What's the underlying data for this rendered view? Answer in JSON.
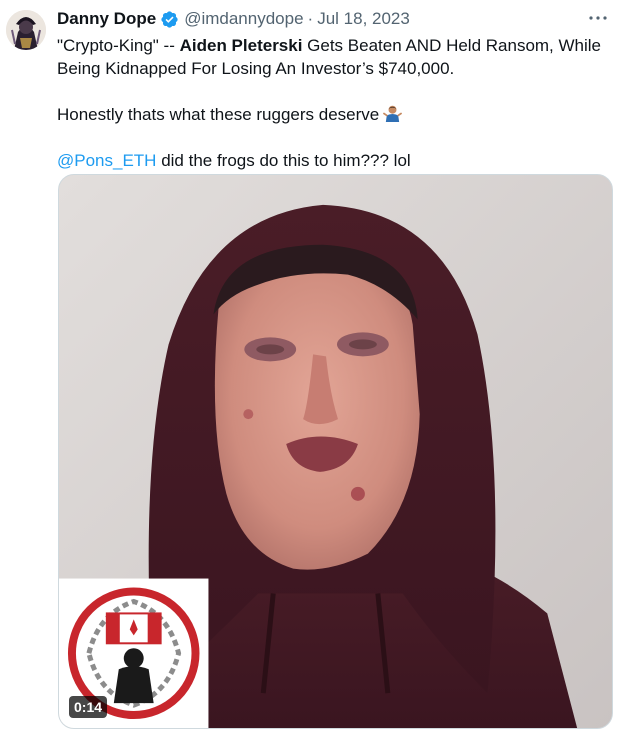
{
  "tweet": {
    "author": {
      "display_name": "Danny Dope",
      "handle": "@imdannydope",
      "verified": true
    },
    "separator": "·",
    "date": "Jul 18, 2023",
    "more_icon": "more-dots-icon",
    "text": {
      "line1_prefix": "\"Crypto-King\" -- ",
      "line1_bold": "Aiden Pleterski",
      "line1_suffix": " Gets Beaten AND Held Ransom, While Being Kidnapped For Losing An Investor’s $740,000.",
      "line2": "Honestly thats what these ruggers deserve",
      "line2_emoji": "person-shrugging-emoji",
      "line3_mention": "@Pons_ETH",
      "line3_rest": " did the frogs do this to him??? lol"
    },
    "media": {
      "type": "video",
      "duration": "0:14"
    }
  },
  "colors": {
    "text_primary": "#0f1419",
    "text_secondary": "#536471",
    "link": "#1d9bf0",
    "verified_badge": "#1d9bf0"
  }
}
